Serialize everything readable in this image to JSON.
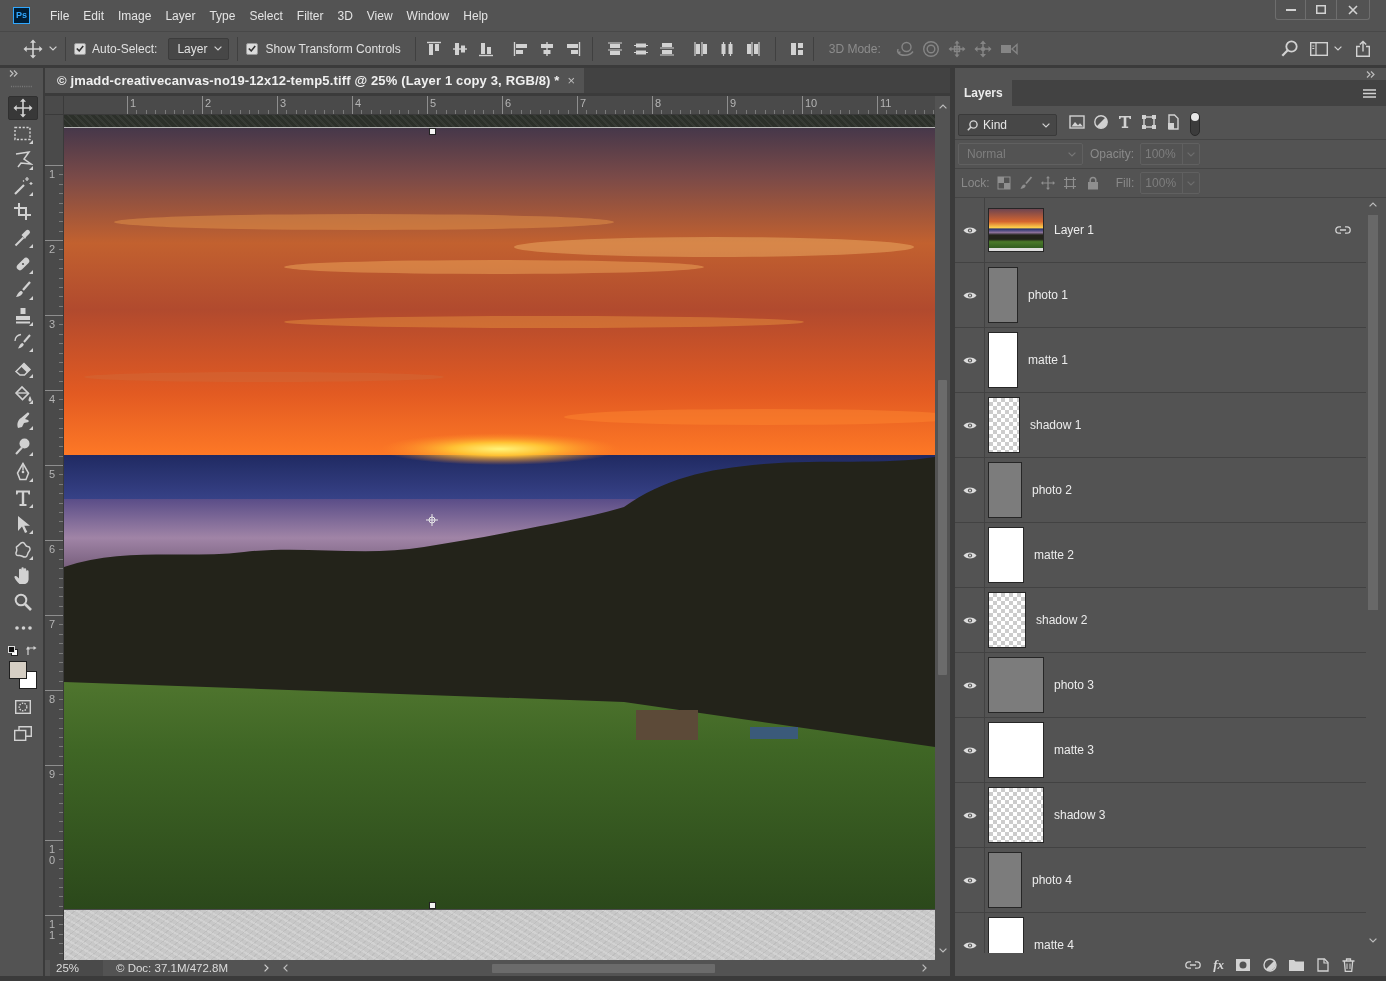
{
  "menu_bar": {
    "logo": "Ps",
    "items": [
      "File",
      "Edit",
      "Image",
      "Layer",
      "Type",
      "Select",
      "Filter",
      "3D",
      "View",
      "Window",
      "Help"
    ]
  },
  "options_bar": {
    "auto_select": {
      "label": "Auto-Select:",
      "checked": true
    },
    "auto_select_target": "Layer",
    "show_transform_controls": {
      "label": "Show Transform Controls",
      "checked": true
    },
    "mode_3d": {
      "label": "3D Mode:",
      "disabled": true
    }
  },
  "tools": [
    {
      "kind": "move",
      "selected": true
    },
    {
      "kind": "marquee",
      "selected": false
    },
    {
      "kind": "lasso",
      "selected": false
    },
    {
      "kind": "magic_wand",
      "selected": false
    },
    {
      "kind": "crop",
      "selected": false
    },
    {
      "kind": "eyedropper",
      "selected": false
    },
    {
      "kind": "healing_brush",
      "selected": false
    },
    {
      "kind": "brush",
      "selected": false
    },
    {
      "kind": "clone_stamp",
      "selected": false
    },
    {
      "kind": "history_brush",
      "selected": false
    },
    {
      "kind": "eraser",
      "selected": false
    },
    {
      "kind": "paint_bucket",
      "selected": false
    },
    {
      "kind": "smudge",
      "selected": false
    },
    {
      "kind": "dodge",
      "selected": false
    },
    {
      "kind": "pen",
      "selected": false
    },
    {
      "kind": "type",
      "selected": false
    },
    {
      "kind": "path_selection",
      "selected": false
    },
    {
      "kind": "custom_shape",
      "selected": false
    },
    {
      "kind": "hand",
      "selected": false
    },
    {
      "kind": "zoom",
      "selected": false
    },
    {
      "kind": "edit_toolbar",
      "selected": false
    }
  ],
  "colors": [
    {
      "kind": "foreground",
      "color": "#d6cfc4"
    },
    {
      "kind": "background",
      "color": "#ffffff"
    }
  ],
  "document": {
    "tab_title": "© jmadd-creativecanvas-no19-12x12-temp5.tiff @ 25% (Layer 1 copy 3, RGB/8) *",
    "close": "×",
    "horizontal_ruler": [
      "1",
      "2",
      "3",
      "4",
      "5",
      "6",
      "7",
      "8",
      "9",
      "10",
      "11"
    ],
    "vertical_ruler": [
      "1",
      "2",
      "3",
      "4",
      "5",
      "6",
      "7",
      "8",
      "9",
      "10",
      "11"
    ],
    "zoom": "25%",
    "doc_info": "© Doc: 37.1M/472.8M"
  },
  "layers_panel": {
    "tab": "Layers",
    "filter": "Kind",
    "disabled": true,
    "blend_mode": "Normal",
    "opacity_label": "Opacity:",
    "opacity": "100%",
    "lock_label": "Lock:",
    "fill_label": "Fill:",
    "fill": "100%",
    "layers": [
      {
        "name": "Layer 1",
        "kind": "photo",
        "visible": true,
        "linked": true,
        "selected": false
      },
      {
        "name": "photo 1",
        "kind": "gray",
        "visible": true,
        "linked": false,
        "selected": false
      },
      {
        "name": "matte 1",
        "kind": "white",
        "visible": true,
        "linked": false,
        "selected": false
      },
      {
        "name": "shadow 1",
        "kind": "transparent",
        "visible": true,
        "linked": false,
        "selected": false
      },
      {
        "name": "photo 2",
        "kind": "gray",
        "visible": true,
        "linked": false,
        "selected": false
      },
      {
        "name": "matte 2",
        "kind": "white",
        "visible": true,
        "linked": false,
        "selected": false
      },
      {
        "name": "shadow 2",
        "kind": "transparent",
        "visible": true,
        "linked": false,
        "selected": false
      },
      {
        "name": "photo 3",
        "kind": "gray",
        "visible": true,
        "linked": false,
        "selected": false
      },
      {
        "name": "matte 3",
        "kind": "white",
        "visible": true,
        "linked": false,
        "selected": false
      },
      {
        "name": "shadow 3",
        "kind": "transparent",
        "visible": true,
        "linked": false,
        "selected": false
      },
      {
        "name": "photo 4",
        "kind": "gray",
        "visible": true,
        "linked": false,
        "selected": false
      },
      {
        "name": "matte 4",
        "kind": "white",
        "visible": true,
        "linked": false,
        "selected": false
      }
    ],
    "styles_button": "fx"
  }
}
